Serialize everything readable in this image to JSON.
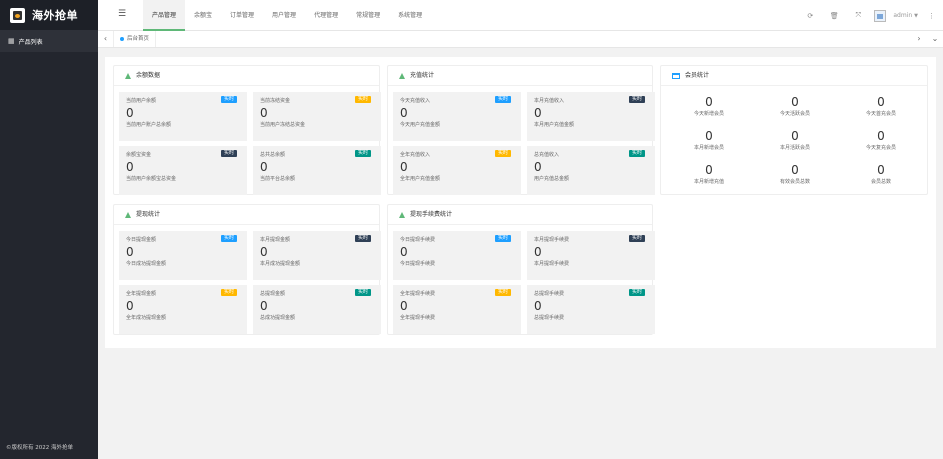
{
  "app": {
    "logo_text": "海外抢单",
    "copyright": "©版权所有 2022 海外抢单"
  },
  "sidebar": {
    "items": [
      {
        "label": "产品列表"
      }
    ]
  },
  "header": {
    "tabs": [
      {
        "label": "产品管理"
      },
      {
        "label": "余额宝"
      },
      {
        "label": "订单管理"
      },
      {
        "label": "用户管理"
      },
      {
        "label": "代理管理"
      },
      {
        "label": "常规管理"
      },
      {
        "label": "系统管理"
      }
    ],
    "user": "admin"
  },
  "tabbar": {
    "current": "后台首页"
  },
  "cards": [
    {
      "title": "余额数据",
      "stats": [
        {
          "title": "当前用户余额",
          "badge": "实时",
          "color": "#1e9fff",
          "value": "0",
          "desc": "当前用户账户总余额"
        },
        {
          "title": "当前冻结资金",
          "badge": "实时",
          "color": "#ffb800",
          "value": "0",
          "desc": "当前用户冻结总资金"
        },
        {
          "title": "余额宝资金",
          "badge": "实时",
          "color": "#2f4056",
          "value": "0",
          "desc": "当前用户余额宝总资金"
        },
        {
          "title": "总共总余额",
          "badge": "实时",
          "color": "#009688",
          "value": "0",
          "desc": "当前平台总余额"
        }
      ]
    },
    {
      "title": "充值统计",
      "stats": [
        {
          "title": "今天充值收入",
          "badge": "实时",
          "color": "#1e9fff",
          "value": "0",
          "desc": "今天用户充值金额"
        },
        {
          "title": "本月充值收入",
          "badge": "实时",
          "color": "#2f4056",
          "value": "0",
          "desc": "本月用户充值金额"
        },
        {
          "title": "全年充值收入",
          "badge": "实时",
          "color": "#ffb800",
          "value": "0",
          "desc": "全年用户充值金额"
        },
        {
          "title": "总充值收入",
          "badge": "实时",
          "color": "#009688",
          "value": "0",
          "desc": "用户充值总金额"
        }
      ]
    },
    {
      "title": "提现统计",
      "stats": [
        {
          "title": "今日提现金额",
          "badge": "实时",
          "color": "#1e9fff",
          "value": "0",
          "desc": "今日成功提现金额"
        },
        {
          "title": "本月提现金额",
          "badge": "实时",
          "color": "#2f4056",
          "value": "0",
          "desc": "本月成功提现金额"
        },
        {
          "title": "全年提现金额",
          "badge": "实时",
          "color": "#ffb800",
          "value": "0",
          "desc": "全年成功提现金额"
        },
        {
          "title": "总提现金额",
          "badge": "实时",
          "color": "#009688",
          "value": "0",
          "desc": "总成功提现金额"
        }
      ]
    },
    {
      "title": "提现手续费统计",
      "stats": [
        {
          "title": "今日提现手续费",
          "badge": "实时",
          "color": "#1e9fff",
          "value": "0",
          "desc": "今日提现手续费"
        },
        {
          "title": "本月提现手续费",
          "badge": "实时",
          "color": "#2f4056",
          "value": "0",
          "desc": "本月提现手续费"
        },
        {
          "title": "全年提现手续费",
          "badge": "实时",
          "color": "#ffb800",
          "value": "0",
          "desc": "全年提现手续费"
        },
        {
          "title": "总提现手续费",
          "badge": "实时",
          "color": "#009688",
          "value": "0",
          "desc": "总提现手续费"
        }
      ]
    }
  ],
  "members": {
    "title": "会员统计",
    "items": [
      {
        "value": "0",
        "label": "今天新增会员"
      },
      {
        "value": "0",
        "label": "今天活跃会员"
      },
      {
        "value": "0",
        "label": "今天首充会员"
      },
      {
        "value": "0",
        "label": "本月新增会员"
      },
      {
        "value": "0",
        "label": "本月活跃会员"
      },
      {
        "value": "0",
        "label": "今天复充会员"
      },
      {
        "value": "0",
        "label": "本月新增充值"
      },
      {
        "value": "0",
        "label": "有效会员总数"
      },
      {
        "value": "0",
        "label": "会员总数"
      }
    ]
  }
}
